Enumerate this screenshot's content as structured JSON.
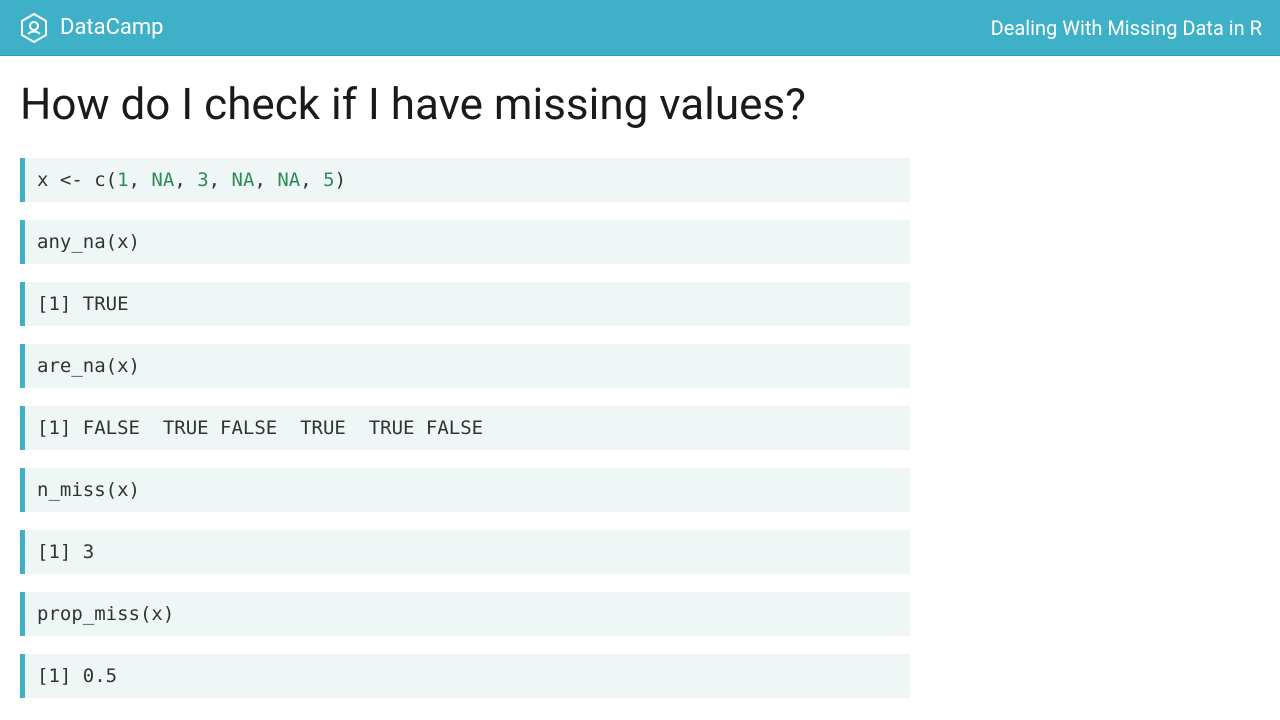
{
  "header": {
    "brand": "DataCamp",
    "course": "Dealing With Missing Data in R"
  },
  "slide": {
    "title": "How do I check if I have missing values?"
  },
  "blocks": [
    {
      "type": "code",
      "tokens": [
        {
          "t": "x <- c(",
          "c": ""
        },
        {
          "t": "1",
          "c": "tok-num"
        },
        {
          "t": ", ",
          "c": ""
        },
        {
          "t": "NA",
          "c": "tok-na"
        },
        {
          "t": ", ",
          "c": ""
        },
        {
          "t": "3",
          "c": "tok-num"
        },
        {
          "t": ", ",
          "c": ""
        },
        {
          "t": "NA",
          "c": "tok-na"
        },
        {
          "t": ", ",
          "c": ""
        },
        {
          "t": "NA",
          "c": "tok-na"
        },
        {
          "t": ", ",
          "c": ""
        },
        {
          "t": "5",
          "c": "tok-num"
        },
        {
          "t": ")",
          "c": ""
        }
      ]
    },
    {
      "type": "code",
      "text": "any_na(x)"
    },
    {
      "type": "output",
      "text": "[1] TRUE"
    },
    {
      "type": "code",
      "text": "are_na(x)"
    },
    {
      "type": "output",
      "text": "[1] FALSE  TRUE FALSE  TRUE  TRUE FALSE"
    },
    {
      "type": "code",
      "text": "n_miss(x)"
    },
    {
      "type": "output",
      "text": "[1] 3"
    },
    {
      "type": "code",
      "text": "prop_miss(x)"
    },
    {
      "type": "output",
      "text": "[1] 0.5"
    }
  ]
}
